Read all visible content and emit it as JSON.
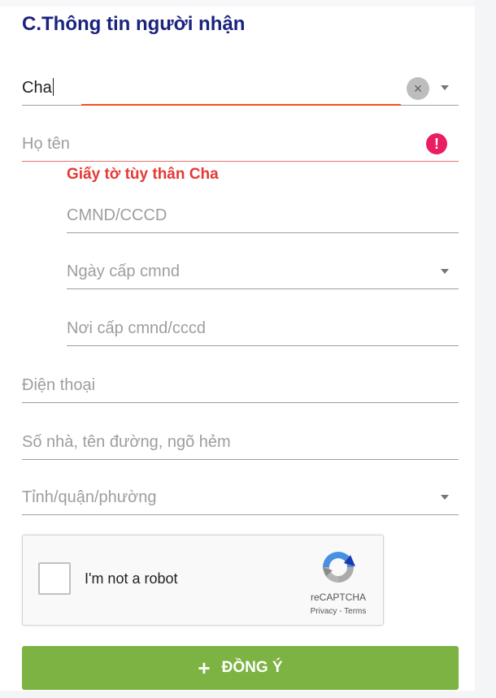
{
  "section_title": "C.Thông tin người nhận",
  "relation": {
    "value": "Cha",
    "clear_icon": "close-icon",
    "arrow_icon": "chevron-down-icon"
  },
  "full_name": {
    "placeholder": "Họ tên",
    "error_icon": "exclamation-icon"
  },
  "id_section_label": "Giấy tờ tùy thân Cha",
  "id_number": {
    "placeholder": "CMND/CCCD"
  },
  "issue_date": {
    "placeholder": "Ngày cấp cmnd"
  },
  "issue_place": {
    "placeholder": "Nơi cấp cmnd/cccd"
  },
  "phone": {
    "placeholder": "Điện thoại"
  },
  "address": {
    "placeholder": "Số nhà, tên đường, ngõ hẻm"
  },
  "region": {
    "placeholder": "Tỉnh/quận/phường"
  },
  "recaptcha": {
    "label": "I'm not a robot",
    "brand": "reCAPTCHA",
    "links": "Privacy - Terms"
  },
  "submit": {
    "icon": "+",
    "label": "ĐỒNG Ý"
  },
  "colors": {
    "title": "#1a237e",
    "error": "#e53935",
    "focus": "#f4511e",
    "button": "#7cb342"
  }
}
